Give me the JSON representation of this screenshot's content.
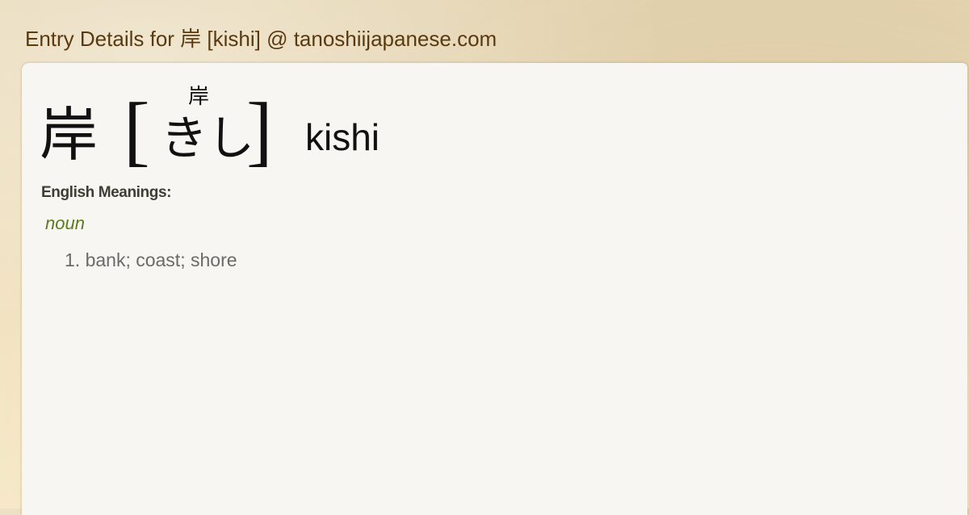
{
  "page": {
    "title": "Entry Details for 岸 [kishi] @ tanoshiijapanese.com"
  },
  "entry": {
    "kanji": "岸",
    "bracket_open": "[",
    "bracket_close": "]",
    "furigana_kanji": "岸",
    "kana": "きし",
    "romaji": "kishi"
  },
  "meanings": {
    "heading": "English Meanings:",
    "part_of_speech": "noun",
    "items": [
      {
        "text": "1. bank; coast; shore"
      }
    ]
  },
  "colors": {
    "title": "#5a3a10",
    "part_of_speech": "#5b7c1e",
    "meaning_text": "#6a6a6a",
    "card_background": "#f7f6f2"
  }
}
